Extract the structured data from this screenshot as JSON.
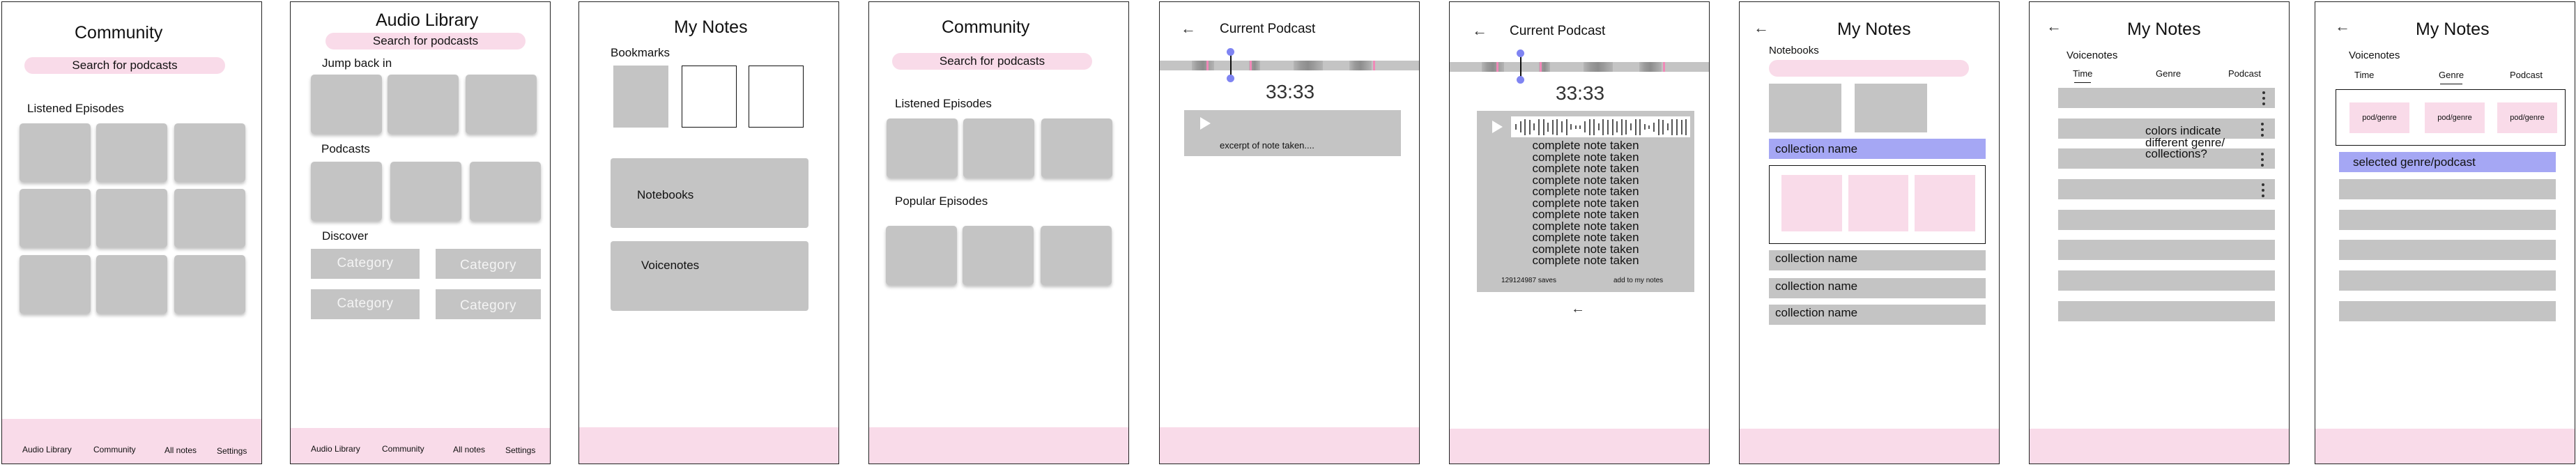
{
  "colors": {
    "accent_pink": "#f9dbe9",
    "placeholder_gray": "#c4c4c4",
    "selected_purple": "#a5a7f4",
    "scrubber_dot": "#7f84f2",
    "marker_pink": "#f08ab8"
  },
  "bottom_nav": {
    "items": [
      {
        "label": "Audio Library"
      },
      {
        "label": "Community"
      },
      {
        "label": "All notes"
      },
      {
        "label": "Settings"
      }
    ]
  },
  "screen1": {
    "title": "Community",
    "search_placeholder": "Search for podcasts",
    "section": "Listened Episodes"
  },
  "screen2": {
    "title": "Audio Library",
    "search_placeholder": "Search for podcasts",
    "sections": {
      "jump_back_in": "Jump back in",
      "podcasts": "Podcasts",
      "discover": "Discover"
    },
    "categories": [
      "Category",
      "Category",
      "Category",
      "Category"
    ]
  },
  "screen3": {
    "title": "My Notes",
    "bookmarks_label": "Bookmarks",
    "notebooks_label": "Notebooks",
    "voicenotes_label": "Voicenotes"
  },
  "screen4": {
    "title": "Community",
    "search_placeholder": "Search for podcasts",
    "listened_label": "Listened Episodes",
    "popular_label": "Popular Episodes"
  },
  "screen5": {
    "back_icon": "arrow-left-icon",
    "title": "Current Podcast",
    "timestamp": "33:33",
    "note_excerpt": "excerpt of note taken...."
  },
  "screen6": {
    "back_icon": "arrow-left-icon",
    "title": "Current Podcast",
    "timestamp": "33:33",
    "note_lines": [
      "complete note taken",
      "complete note taken",
      "complete note taken",
      "complete note taken",
      "complete note taken",
      "complete note taken",
      "complete note taken",
      "complete note taken",
      "complete note taken",
      "complete note taken",
      "complete note taken"
    ],
    "saves": "129124987 saves",
    "add_to_notes": "add to my notes"
  },
  "screen7": {
    "title": "My Notes",
    "section": "Notebooks",
    "selected_collection": "collection name",
    "collections": [
      "collection name",
      "collection name",
      "collection name"
    ]
  },
  "screen8": {
    "title": "My Notes",
    "section": "Voicenotes",
    "tabs": [
      {
        "label": "Time",
        "active": true
      },
      {
        "label": "Genre",
        "active": false
      },
      {
        "label": "Podcast",
        "active": false
      }
    ],
    "annotation": "colors indicate different genre/ collections?"
  },
  "screen9": {
    "title": "My Notes",
    "section": "Voicenotes",
    "tabs": [
      {
        "label": "Time",
        "active": false
      },
      {
        "label": "Genre",
        "active": true
      },
      {
        "label": "Podcast",
        "active": false
      }
    ],
    "filters": [
      "pod/genre",
      "pod/genre",
      "pod/genre"
    ],
    "selected": "selected genre/podcast"
  }
}
